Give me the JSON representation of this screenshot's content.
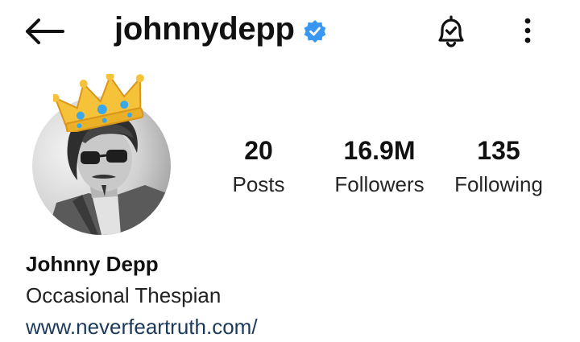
{
  "header": {
    "username": "johnnydepp",
    "back_icon": "arrow-left-icon",
    "verified_icon": "verified-badge-icon",
    "notification_icon": "bell-check-icon",
    "more_icon": "more-vertical-icon"
  },
  "profile": {
    "avatar_icon": "profile-photo",
    "crown_icon": "crown-icon"
  },
  "stats": [
    {
      "value": "20",
      "label": "Posts"
    },
    {
      "value": "16.9M",
      "label": "Followers"
    },
    {
      "value": "135",
      "label": "Following"
    }
  ],
  "bio": {
    "name": "Johnny Depp",
    "description": "Occasional Thespian",
    "link": "www.neverfeartruth.com/"
  },
  "colors": {
    "verified": "#3897f0",
    "link": "#1b3a5b",
    "text": "#111111"
  }
}
